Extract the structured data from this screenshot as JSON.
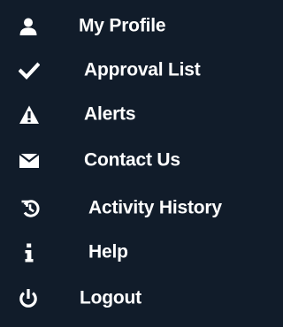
{
  "menu": {
    "items": [
      {
        "label": "My Profile",
        "icon": "user-icon"
      },
      {
        "label": "Approval List",
        "icon": "checkmark-icon"
      },
      {
        "label": "Alerts",
        "icon": "warning-icon"
      },
      {
        "label": "Contact Us",
        "icon": "envelope-icon"
      },
      {
        "label": "Activity History",
        "icon": "history-icon"
      },
      {
        "label": "Help",
        "icon": "info-icon"
      },
      {
        "label": "Logout",
        "icon": "power-icon"
      }
    ]
  },
  "colors": {
    "background": "#111c2a",
    "text": "#ffffff",
    "icon": "#ffffff"
  }
}
